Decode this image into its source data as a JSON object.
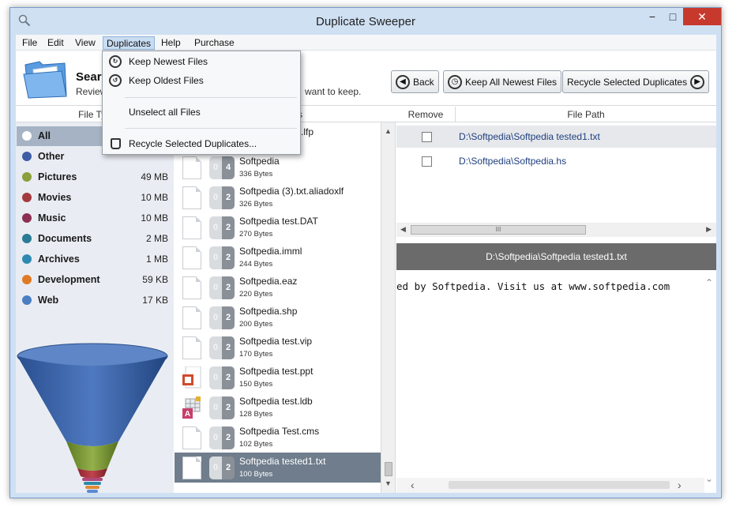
{
  "window": {
    "title": "Duplicate Sweeper",
    "min": "−",
    "max": "□",
    "close": "✕"
  },
  "menubar": [
    "File",
    "Edit",
    "View",
    "Duplicates",
    "Help",
    "Purchase"
  ],
  "duplicates_menu": {
    "keep_newest": "Keep Newest Files",
    "keep_oldest": "Keep Oldest Files",
    "unselect_all": "Unselect all Files",
    "recycle_selected": "Recycle Selected Duplicates..."
  },
  "header": {
    "title": "Sear",
    "subtitle": "Review",
    "subtitle_tail": "want to keep.",
    "back_label": "Back",
    "keep_all_newest_label": "Keep All Newest Files",
    "recycle_selected_label": "Recycle Selected Duplicates"
  },
  "columns": {
    "file_types": "File Typ",
    "groups": "oups",
    "remove": "Remove",
    "file_path": "File Path"
  },
  "categories": [
    {
      "name": "All",
      "size": "",
      "color": "#ffffff",
      "selected": true
    },
    {
      "name": "Other",
      "size": "",
      "color": "#3e5da6"
    },
    {
      "name": "Pictures",
      "size": "49 MB",
      "color": "#8aa03c"
    },
    {
      "name": "Movies",
      "size": "10 MB",
      "color": "#a33a3f"
    },
    {
      "name": "Music",
      "size": "10 MB",
      "color": "#8c2f52"
    },
    {
      "name": "Documents",
      "size": "2 MB",
      "color": "#2a7b96"
    },
    {
      "name": "Archives",
      "size": "1 MB",
      "color": "#2f8ab3"
    },
    {
      "name": "Development",
      "size": "59 KB",
      "color": "#e07b25"
    },
    {
      "name": "Web",
      "size": "17 KB",
      "color": "#4a7fc2"
    }
  ],
  "file_groups": [
    {
      "name": "pf.lfp",
      "size": "",
      "c1": "",
      "c2": ""
    },
    {
      "name": "Softpedia",
      "size": "336 Bytes",
      "c1": "0",
      "c2": "4"
    },
    {
      "name": "Softpedia (3).txt.aliadoxlf",
      "size": "326 Bytes",
      "c1": "0",
      "c2": "2"
    },
    {
      "name": "Softpedia test.DAT",
      "size": "270 Bytes",
      "c1": "0",
      "c2": "2"
    },
    {
      "name": "Softpedia.imml",
      "size": "244 Bytes",
      "c1": "0",
      "c2": "2"
    },
    {
      "name": "Softpedia.eaz",
      "size": "220 Bytes",
      "c1": "0",
      "c2": "2"
    },
    {
      "name": "Softpedia.shp",
      "size": "200 Bytes",
      "c1": "0",
      "c2": "2"
    },
    {
      "name": "Softpedia test.vip",
      "size": "170 Bytes",
      "c1": "0",
      "c2": "2"
    },
    {
      "name": "Softpedia test.ppt",
      "size": "150 Bytes",
      "c1": "0",
      "c2": "2"
    },
    {
      "name": "Softpedia test.ldb",
      "size": "128 Bytes",
      "c1": "0",
      "c2": "2"
    },
    {
      "name": "Softpedia Test.cms",
      "size": "102 Bytes",
      "c1": "0",
      "c2": "2"
    },
    {
      "name": "Softpedia tested1.txt",
      "size": "100 Bytes",
      "c1": "0",
      "c2": "2",
      "selected": true
    }
  ],
  "duplicates": [
    {
      "path": "D:\\Softpedia\\Softpedia tested1.txt",
      "checked": false,
      "selected": true
    },
    {
      "path": "D:\\Softpedia\\Softpedia.hs",
      "checked": false
    }
  ],
  "preview": {
    "title": "D:\\Softpedia\\Softpedia tested1.txt",
    "text": "ed by Softpedia. Visit us at www.softpedia.com"
  },
  "scrollbar_grip": "III"
}
